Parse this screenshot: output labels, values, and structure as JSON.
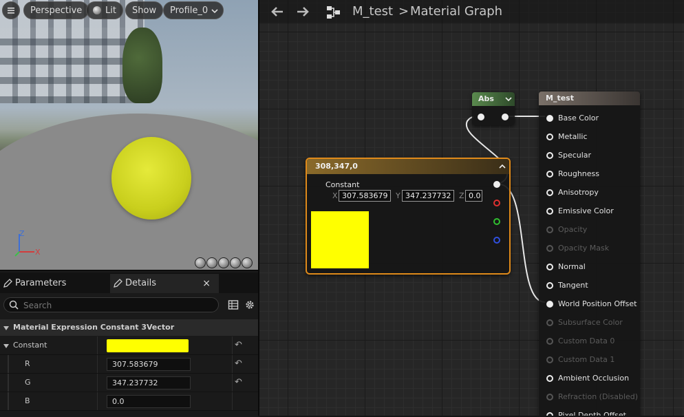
{
  "viewport": {
    "buttons": {
      "menu_icon": "hamburger-icon",
      "perspective": "Perspective",
      "lit": "Lit",
      "show": "Show",
      "profile": "Profile_0"
    },
    "axis_labels": {
      "z": "Z",
      "x": "X"
    },
    "sphere_color": "#d6dc2a"
  },
  "details": {
    "tabs": [
      {
        "label": "Parameters"
      },
      {
        "label": "Details"
      }
    ],
    "close": "×",
    "search": {
      "placeholder": "Search"
    },
    "section_title": "Material Expression Constant 3Vector",
    "constant": {
      "label": "Constant",
      "color": "#ffff00"
    },
    "rows": [
      {
        "label": "R",
        "value": "307.583679"
      },
      {
        "label": "G",
        "value": "347.237732"
      },
      {
        "label": "B",
        "value": "0.0"
      }
    ],
    "reset_icon": "undo-arrow-icon"
  },
  "graph": {
    "breadcrumb": {
      "asset": "M_test",
      "separator": ">",
      "page": "Material Graph"
    },
    "abs_node": {
      "title": "Abs",
      "header_color": "#4f7a44"
    },
    "constant_node": {
      "title": "308,347,0",
      "subtitle": "Constant",
      "x_label": "X",
      "x": "307.583679",
      "y_label": "Y",
      "y": "347.237732",
      "z_label": "Z",
      "z": "0.0",
      "preview_color": "#ffff00",
      "pin_colors": [
        "#ffffff",
        "#e03030",
        "#30c030",
        "#3050e0"
      ]
    },
    "material_node": {
      "title": "M_test",
      "inputs": [
        {
          "label": "Base Color",
          "state": "connected"
        },
        {
          "label": "Metallic",
          "state": "active"
        },
        {
          "label": "Specular",
          "state": "active"
        },
        {
          "label": "Roughness",
          "state": "active"
        },
        {
          "label": "Anisotropy",
          "state": "active"
        },
        {
          "label": "Emissive Color",
          "state": "active"
        },
        {
          "label": "Opacity",
          "state": "disabled"
        },
        {
          "label": "Opacity Mask",
          "state": "disabled"
        },
        {
          "label": "Normal",
          "state": "active"
        },
        {
          "label": "Tangent",
          "state": "active"
        },
        {
          "label": "World Position Offset",
          "state": "connected"
        },
        {
          "label": "Subsurface Color",
          "state": "disabled"
        },
        {
          "label": "Custom Data 0",
          "state": "disabled"
        },
        {
          "label": "Custom Data 1",
          "state": "disabled"
        },
        {
          "label": "Ambient Occlusion",
          "state": "active"
        },
        {
          "label": "Refraction (Disabled)",
          "state": "disabled"
        },
        {
          "label": "Pixel Depth Offset",
          "state": "active"
        }
      ]
    }
  }
}
